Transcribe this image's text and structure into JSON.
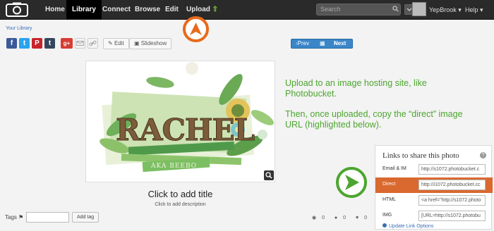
{
  "nav": {
    "items": [
      "Home",
      "Library",
      "Connect",
      "Browse",
      "Edit",
      "Upload"
    ],
    "search_placeholder": "Search",
    "user": "YepBrook",
    "help": "Help"
  },
  "breadcrumb": "Your Library",
  "share_buttons": [
    "f",
    "t",
    "P",
    "t",
    "g+"
  ],
  "toolbar": {
    "edit": "Edit",
    "slideshow": "Slideshow"
  },
  "pager": {
    "prev": "Prev",
    "next": "Next"
  },
  "photo": {
    "art_text": "RACHEL",
    "art_sub": "AKA BEEBO",
    "title": "Click to add title",
    "description": "Click to add description"
  },
  "instructions": {
    "line1": "Upload to an image hosting site, like Photobucket.",
    "line2": "Then, once uploaded, copy the “direct” image URL (highlighted below)."
  },
  "links_panel": {
    "title": "Links to share this photo",
    "rows": [
      {
        "label": "Email & IM",
        "value": "http://s1072.photobucket.c"
      },
      {
        "label": "Direct",
        "value": "http://i1072.photobucket.cc"
      },
      {
        "label": "HTML",
        "value": "<a href=\"http://s1072.photo"
      },
      {
        "label": "IMG",
        "value": "[URL=http://s1072.photobu"
      }
    ],
    "update": "Update Link Options"
  },
  "tags": {
    "label": "Tags",
    "add": "Add tag"
  },
  "stats": {
    "views": "0",
    "comments": "0",
    "likes": "0"
  },
  "colors": {
    "accent_green": "#4ca52f",
    "accent_orange": "#e76a1c"
  }
}
